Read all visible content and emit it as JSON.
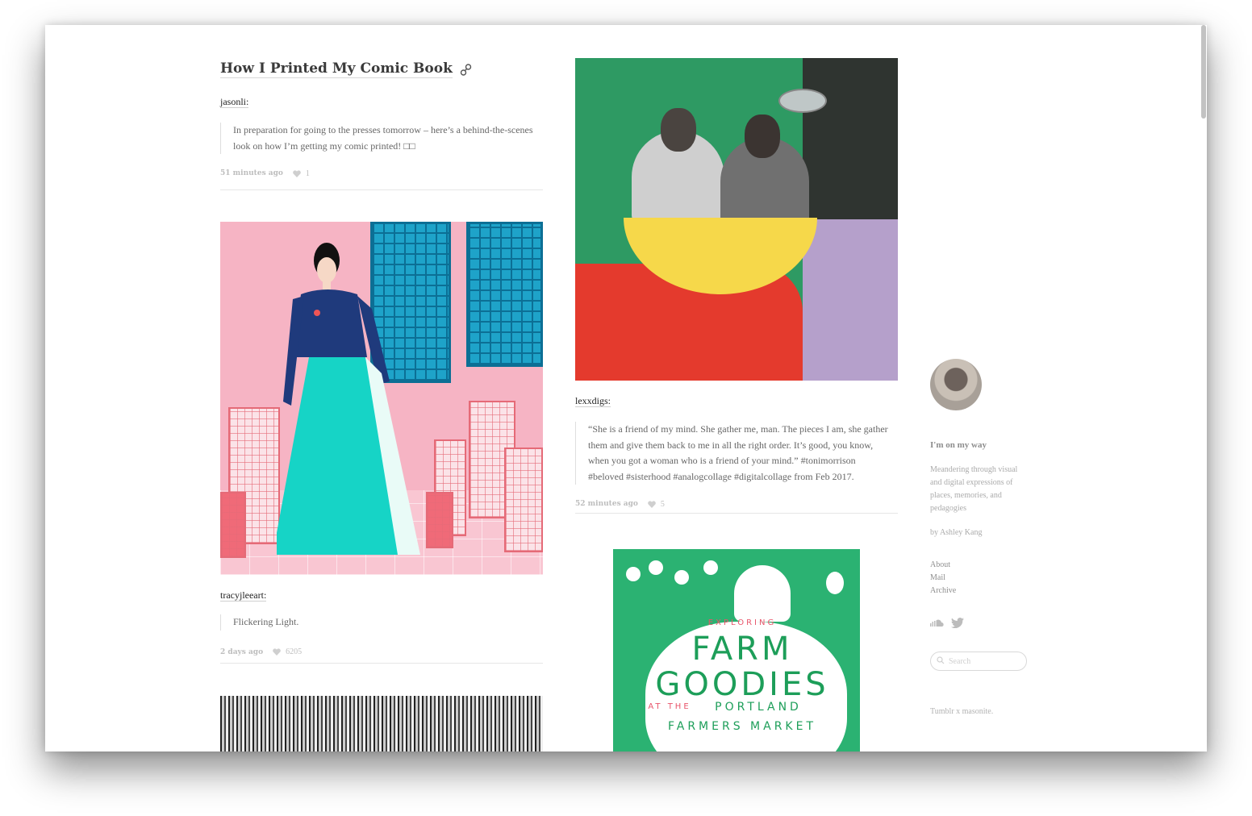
{
  "posts_left": [
    {
      "title": "How I Printed My Comic Book",
      "reblog_user": "jasonli:",
      "quote": "In preparation for going to the presses tomorrow – here’s a behind-the-scenes look on how I’m getting my comic printed! □□",
      "time": "51 minutes ago",
      "notes": "1"
    },
    {
      "reblog_user": "tracyjleeart:",
      "quote": "Flickering Light.",
      "time": "2 days ago",
      "notes": "6205"
    }
  ],
  "posts_right": [
    {
      "reblog_user": "lexxdigs:",
      "quote": "“She is a friend of my mind. She gather me, man. The pieces I am, she gather them and give them back to me in all the right order. It’s good, you know, when you got a woman who is a friend of your mind.” #tonimorrison #beloved #sisterhood #analogcollage #digitalcollage from Feb 2017.",
      "time": "52 minutes ago",
      "notes": "5"
    },
    {
      "artwork_text": {
        "exploring": "EXPLORING",
        "farm": "FARM",
        "goodies": "GOODIES",
        "at_the": "AT THE",
        "portland": "PORTLAND",
        "farmers_market": "FARMERS MARKET"
      }
    }
  ],
  "sidebar": {
    "blog_title": "I'm on my way",
    "description": "Meandering through visual and digital expressions of places, memories, and pedagogies",
    "byline": "by Ashley Kang",
    "nav": [
      "About",
      "Mail",
      "Archive"
    ],
    "social_icons": [
      "soundcloud-icon",
      "twitter-icon"
    ],
    "search_placeholder": "Search",
    "credit": "Tumblr x masonite."
  },
  "colors": {
    "meta_gray": "#bdbdbd",
    "hanbok_pink": "#f6b4c4",
    "collage_green": "#2e9a63",
    "farm_green": "#2bb272"
  }
}
